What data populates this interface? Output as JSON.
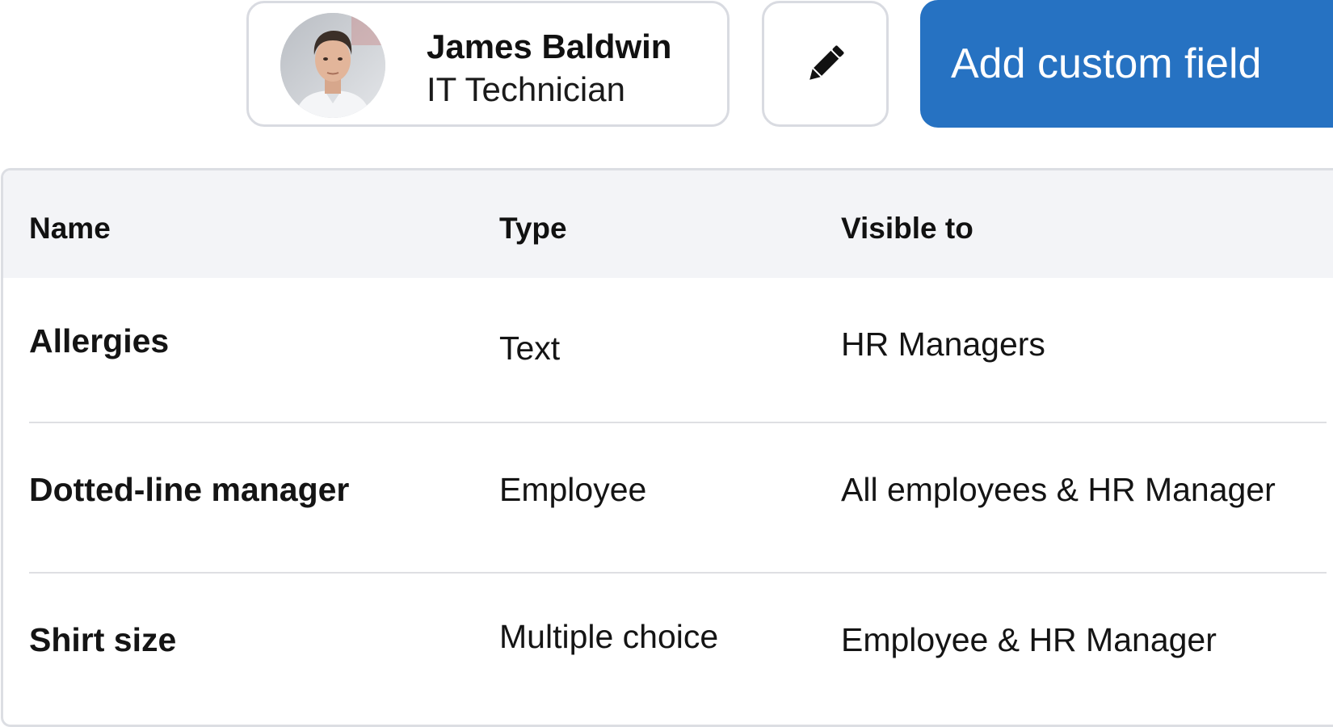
{
  "profile": {
    "name": "James Baldwin",
    "role": "IT Technician"
  },
  "toolbar": {
    "edit_icon": "pencil-icon",
    "add_button_label": "Add custom field"
  },
  "colors": {
    "primary_button": "#2672c2",
    "header_background": "#f3f4f7",
    "border": "#d9dbe1"
  },
  "table": {
    "columns": [
      "Name",
      "Type",
      "Visible to"
    ],
    "rows": [
      {
        "name": "Allergies",
        "type": "Text",
        "visible_to": "HR Managers"
      },
      {
        "name": "Dotted-line manager",
        "type": "Employee",
        "visible_to": "All employees & HR Manager"
      },
      {
        "name": "Shirt size",
        "type": "Multiple choice",
        "visible_to": "Employee & HR Manager"
      }
    ]
  }
}
